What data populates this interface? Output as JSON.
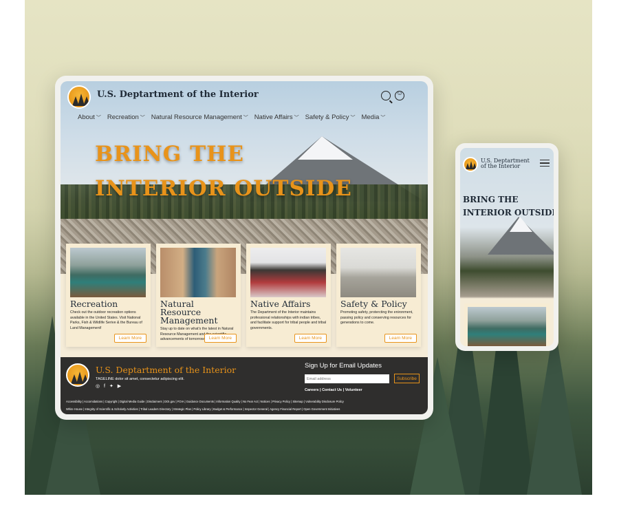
{
  "desktop": {
    "header": {
      "title": "U.S. Deptartment of the Interior",
      "icons": [
        "search-icon",
        "accessibility-icon"
      ]
    },
    "nav": [
      {
        "label": "About",
        "chevron": "﹀"
      },
      {
        "label": "Recreation",
        "chevron": "﹀"
      },
      {
        "label": "Natural Resource Management",
        "chevron": "﹀"
      },
      {
        "label": "Native Affairs",
        "chevron": "﹀"
      },
      {
        "label": "Safety & Policy",
        "chevron": "﹀"
      },
      {
        "label": "Media",
        "chevron": "﹀"
      }
    ],
    "hero": {
      "line1": "BRING THE",
      "line2": "INTERIOR OUTSIDE"
    },
    "cards": [
      {
        "title": "Recreation",
        "text": "Check out the outdoor recreation options available in the United States. Visit National Parks, Fish & Wildlife Serive & the Bureau of Land Management!",
        "button": "Learn More"
      },
      {
        "title": "Natural Resource Management",
        "text": "Stay up to date on what's the latest in Natural Resource Management and the scientific advancements of tomorrow.",
        "button": "Learn More"
      },
      {
        "title": "Native Affairs",
        "text": "The Department of the Interior maintains professional relationships with indian tribes, and facilitate support for tribal people and tribal governments.",
        "button": "Learn More"
      },
      {
        "title": "Safety & Policy",
        "text": "Promoting safety, protercting the enironment, passing policy and conserving resources for generations to come.",
        "button": "Learn More"
      }
    ],
    "footer": {
      "title": "U.S. Deptartment of the Interior",
      "tagline": "TAGELINE dolor sit amet, consectetur adipiscing elit.",
      "social": "◎ f ✦ ▶",
      "signup_title": "Sign Up for Email Updates",
      "email_placeholder": "Email address",
      "subscribe": "Subscribe",
      "top_links": "Careers | Contact Us | Volunteer",
      "links_line1": "Accessibility | Accomidations | Copyright | Digital Media Guide | Disclaimers | DOI.gov | FOIA | Guidance Documents | Information Quality | No Fear Act | Notices | Privacy Policy | Sitemap | Vulnerability Disclosure Policy",
      "links_line2": "White House | Integrity of Scientific & Scholarly Activities | Tribal Leaders Directory | Strategic Plan | Policy Library | Budget & Performance | Inspector General | Agency Financial Report | Open Government Initiatives"
    }
  },
  "mobile": {
    "title": "U.S. Deptartment of the Interior",
    "hero_line1": "BRING THE",
    "hero_line2": "INTERIOR OUTSIDE",
    "menu_icon": "hamburger-menu-icon"
  },
  "colors": {
    "accent": "#e8931a",
    "card_bg": "#f7ecd3",
    "footer_bg": "#2f2e2d",
    "text_dark": "#1f2a36"
  }
}
